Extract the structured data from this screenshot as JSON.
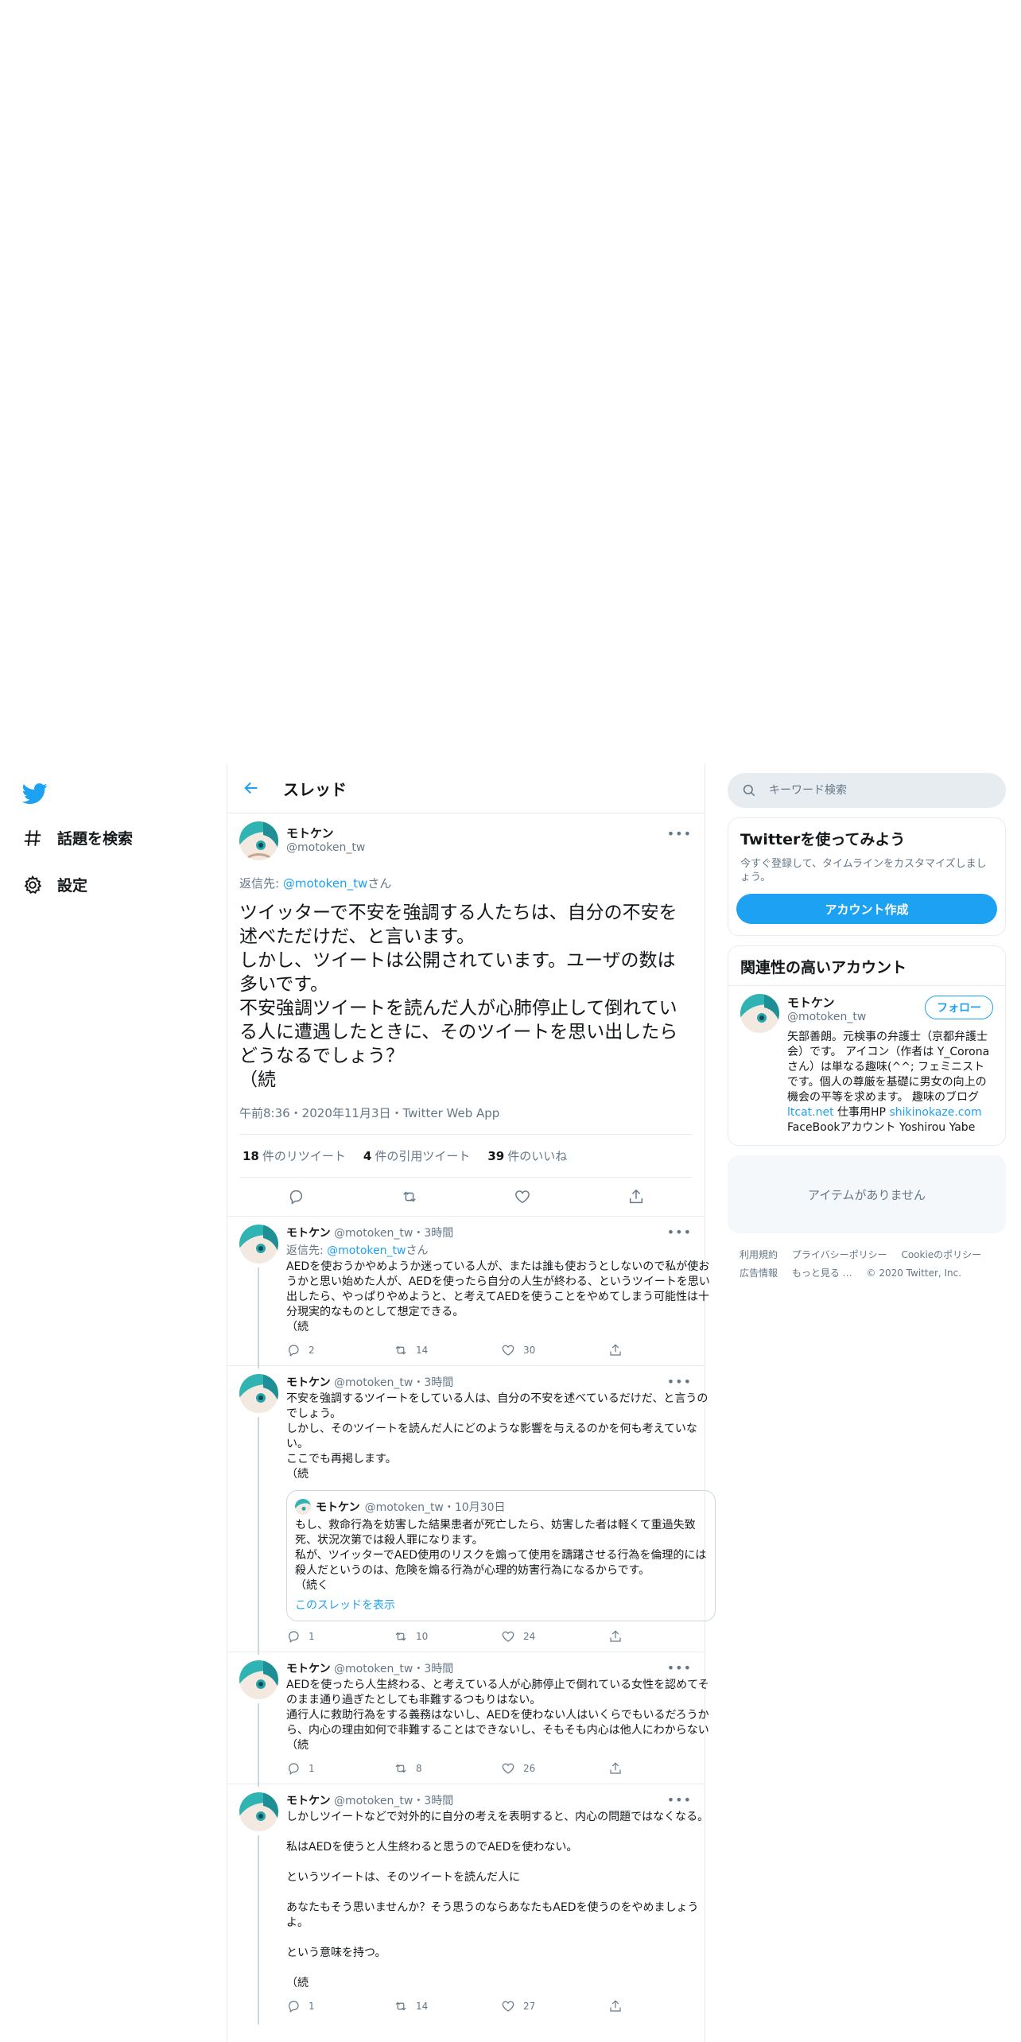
{
  "nav": {
    "explore_label": "話題を検索",
    "settings_label": "設定"
  },
  "header": {
    "title": "スレッド"
  },
  "focus": {
    "display_name": "モトケン",
    "handle": "@motoken_tw",
    "reply_prefix": "返信先: ",
    "reply_handle": "@motoken_tw",
    "reply_suffix": "さん",
    "text": "ツイッターで不安を強調する人たちは、自分の不安を述べただけだ、と言います。\nしかし、ツイートは公開されています。ユーザの数は多いです。\n不安強調ツイートを読んだ人が心肺停止して倒れている人に遭遇したときに、そのツイートを思い出したらどうなるでしょう？\n（続",
    "meta": "午前8:36・2020年11月3日・Twitter Web App",
    "stats": [
      {
        "num": "18",
        "label": "件のリツイート"
      },
      {
        "num": "4",
        "label": "件の引用ツイート"
      },
      {
        "num": "39",
        "label": "件のいいね"
      }
    ]
  },
  "tweets": [
    {
      "display_name": "モトケン",
      "handle": "@motoken_tw",
      "time": "・3時間",
      "reply_prefix": "返信先: ",
      "reply_handle": "@motoken_tw",
      "reply_suffix": "さん",
      "text": "AEDを使おうかやめようか迷っている人が、または誰も使おうとしないので私が使おうかと思い始めた人が、AEDを使ったら自分の人生が終わる、というツイートを思い出したら、やっぱりやめようと、と考えてAEDを使うことをやめてしまう可能性は十分現実的なものとして想定できる。\n（続",
      "replies": "2",
      "retweets": "14",
      "likes": "30"
    },
    {
      "display_name": "モトケン",
      "handle": "@motoken_tw",
      "time": "・3時間",
      "text": "不安を強調するツイートをしている人は、自分の不安を述べているだけだ、と言うのでしょう。\nしかし、そのツイートを読んだ人にどのような影響を与えるのかを何も考えていない。\nここでも再掲します。\n（続",
      "quote": {
        "display_name": "モトケン",
        "handle": "@motoken_tw",
        "time": "・10月30日",
        "text": "もし、救命行為を妨害した結果患者が死亡したら、妨害した者は軽くて重過失致死、状況次第では殺人罪になります。\n私が、ツイッターでAED使用のリスクを煽って使用を躊躇させる行為を倫理的には殺人だというのは、危険を煽る行為が心理的妨害行為になるからです。\n（続く",
        "show_thread": "このスレッドを表示"
      },
      "replies": "1",
      "retweets": "10",
      "likes": "24"
    },
    {
      "display_name": "モトケン",
      "handle": "@motoken_tw",
      "time": "・3時間",
      "text": "AEDを使ったら人生終わる、と考えている人が心肺停止で倒れている女性を認めてそのまま通り過ぎたとしても非難するつもりはない。\n通行人に救助行為をする義務はないし、AEDを使わない人はいくらでもいるだろうから、内心の理由如何で非難することはできないし、そもそも内心は他人にわからない\n（続",
      "replies": "1",
      "retweets": "8",
      "likes": "26"
    },
    {
      "display_name": "モトケン",
      "handle": "@motoken_tw",
      "time": "・3時間",
      "text": "しかしツイートなどで対外的に自分の考えを表明すると、内心の問題ではなくなる。\n\n私はAEDを使うと人生終わると思うのでAEDを使わない。\n\nというツイートは、そのツイートを読んだ人に\n\nあなたもそう思いませんか？そう思うのならあなたもAEDを使うのをやめましょうよ。\n\nという意味を持つ。\n\n（続",
      "replies": "1",
      "retweets": "14",
      "likes": "27"
    }
  ],
  "right": {
    "search_placeholder": "キーワード検索",
    "signup": {
      "title": "Twitterを使ってみよう",
      "desc": "今すぐ登録して、タイムラインをカスタマイズしましょう。",
      "button": "アカウント作成"
    },
    "relevant": {
      "title": "関連性の高いアカウント",
      "display_name": "モトケン",
      "handle": "@motoken_tw",
      "follow": "フォロー",
      "bio_1": "矢部善朗。元検事の弁護士（京都弁護士会）です。 アイコン（作者は Y_Coronaさん）は単なる趣味(^^; フェミニストです。個人の尊厳を基礎に男女の向上の機会の平等を求めます。 趣味のブログ ",
      "bio_link1": "ltcat.net",
      "bio_2": " 仕事用HP ",
      "bio_link2": "shikinokaze.com",
      "bio_3": " FaceBookアカウント Yoshirou Yabe"
    },
    "empty": "アイテムがありません",
    "footer": [
      "利用規約",
      "プライバシーポリシー",
      "Cookieのポリシー",
      "広告情報",
      "もっと見る …",
      "© 2020 Twitter, Inc."
    ]
  },
  "colors": {
    "accent": "#1da1f2",
    "text": "#14171a",
    "muted": "#657786",
    "border": "#e6ecf0"
  }
}
